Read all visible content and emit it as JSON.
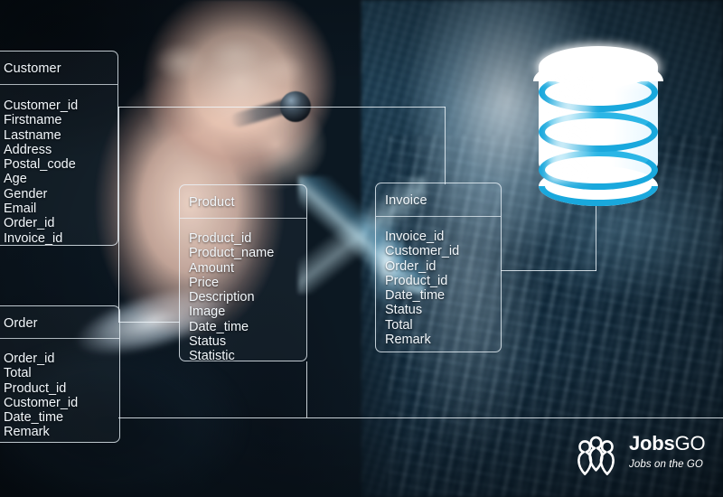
{
  "image": {
    "kind": "er-diagram-over-photo",
    "background_description": "Blurred photo of a hand holding a pen drawing a database schema over a server room"
  },
  "palette": {
    "entity_border": "#ecf4fa",
    "entity_text": "#f2f7fb",
    "connector": "#f0f8fd",
    "db_band": "#19a8dd",
    "db_body": "#ffffff",
    "logo_text": "#ffffff",
    "bg_dark": "#0c1822",
    "bg_blue": "#27566e"
  },
  "entities": [
    {
      "id": "customer",
      "title": "Customer",
      "fields": [
        "Customer_id",
        "Firstname",
        "Lastname",
        "Address",
        "Postal_code",
        "Age",
        "Gender",
        "Email",
        "Order_id",
        "Invoice_id"
      ]
    },
    {
      "id": "order",
      "title": "Order",
      "fields": [
        "Order_id",
        "Total",
        "Product_id",
        "Customer_id",
        "Date_time",
        "Remark"
      ]
    },
    {
      "id": "product",
      "title": "Product",
      "fields": [
        "Product_id",
        "Product_name",
        "Amount",
        "Price",
        "Description",
        "Image",
        "Date_time",
        "Status",
        "Statistic"
      ]
    },
    {
      "id": "invoice",
      "title": "Invoice",
      "fields": [
        "Invoice_id",
        "Customer_id",
        "Order_id",
        "Product_id",
        "Date_time",
        "Status",
        "Total",
        "Remark"
      ]
    }
  ],
  "database_icon": {
    "name": "database-cylinder-icon",
    "bands": 3,
    "color": "#19a8dd"
  },
  "logo": {
    "name": "jobsgo-logo",
    "word_primary": "Jobs",
    "word_secondary": "GO",
    "tagline": "Jobs on the GO",
    "mark": "three-people-icon"
  }
}
